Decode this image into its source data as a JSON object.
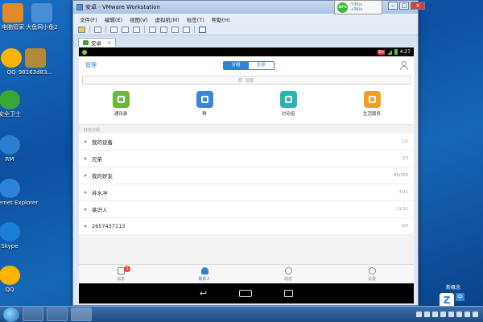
{
  "desktop": {
    "icons": [
      {
        "label": "电脑管家",
        "label2": "",
        "color": "#e08a2a"
      },
      {
        "label": "大鱼网小鱼2",
        "label2": "",
        "color": "#4a8fd6"
      },
      {
        "label": "QQ",
        "label2": "",
        "color": "#ffb400"
      },
      {
        "label": "98163d83...",
        "label2": "",
        "color": "#b08a3a"
      },
      {
        "label": "安全卫士",
        "label2": "",
        "color": "#3aa63a"
      },
      {
        "label": "RM",
        "label2": "",
        "color": "#2a7fd0"
      },
      {
        "label": "Internet Explorer",
        "label2": "",
        "color": "#2d83d8"
      },
      {
        "label": "Skype",
        "label2": "",
        "color": "#1b7fd6"
      },
      {
        "label": "QQ",
        "label2": "",
        "color": "#ffb400"
      }
    ]
  },
  "vmware": {
    "title": "安卓 - VMware Workstation",
    "menu": [
      "文件(F)",
      "编辑(E)",
      "视图(V)",
      "虚拟机(M)",
      "标签(T)",
      "帮助(H)"
    ],
    "tab_label": "安卓",
    "net_meter": {
      "percent": "30%",
      "up": "0K/s",
      "down": "0K/s"
    }
  },
  "android": {
    "status": {
      "lang": "En",
      "time": "4:27"
    },
    "header": {
      "manage": "管理",
      "segments": [
        "分组",
        "全部"
      ]
    },
    "search": {
      "placeholder": "搜索"
    },
    "quick_actions": [
      {
        "label": "通讯录",
        "color": "#6ab940"
      },
      {
        "label": "群",
        "color": "#3a86d6"
      },
      {
        "label": "讨论组",
        "color": "#26b5b0"
      },
      {
        "label": "生活服务",
        "color": "#f0a01e"
      }
    ],
    "group_section_title": "好友分组",
    "groups": [
      {
        "name": "我的设备",
        "count": "1/1"
      },
      {
        "name": "兄弟",
        "count": "3/3"
      },
      {
        "name": "我的好友",
        "count": "86/326"
      },
      {
        "name": "井水冲",
        "count": "4/11"
      },
      {
        "name": "某识人",
        "count": "11/31"
      },
      {
        "name": "2657437113",
        "count": "0/0"
      }
    ],
    "tabs": [
      {
        "label": "消息",
        "badge": "3"
      },
      {
        "label": "联系人"
      },
      {
        "label": "动态"
      },
      {
        "label": "设置"
      }
    ]
  },
  "ime": {
    "label": "新概念",
    "mode": "中"
  }
}
